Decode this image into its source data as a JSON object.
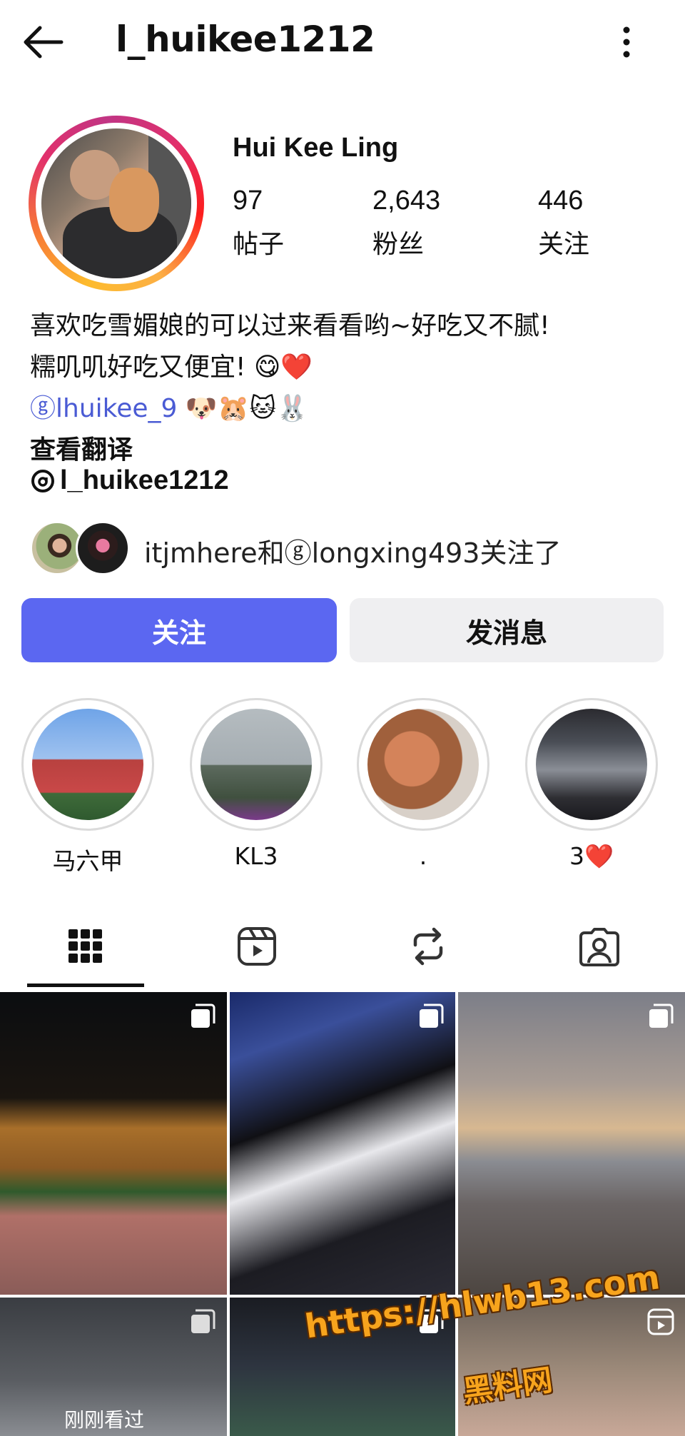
{
  "header": {
    "username": "l_huikee1212",
    "back_icon": "arrow-left-icon",
    "more_icon": "more-vertical-icon"
  },
  "profile": {
    "display_name": "Hui Kee Ling",
    "stats": [
      {
        "value": "97",
        "label": "帖子"
      },
      {
        "value": "2,643",
        "label": "粉丝"
      },
      {
        "value": "446",
        "label": "关注"
      }
    ],
    "bio_line1": "喜欢吃雪媚娘的可以过来看看哟~好吃又不腻!",
    "bio_line2": "糯叽叽好吃又便宜!  😋❤️",
    "bio_mention": "ⓖlhuikee_9",
    "bio_emojis": " 🐶🐹🐱🐰",
    "translate_label": "查看翻译",
    "threads_handle": "l_huikee1212",
    "mutual_followers_text": "itjmhere和ⓖlongxing493关注了"
  },
  "actions": {
    "follow_label": "关注",
    "message_label": "发消息",
    "follow_color": "#5b67f1"
  },
  "highlights": [
    {
      "label": "马六甲"
    },
    {
      "label": "KL3"
    },
    {
      "label": "."
    },
    {
      "label": "3❤️"
    }
  ],
  "tabs": [
    {
      "name": "grid",
      "icon": "grid-icon",
      "active": true
    },
    {
      "name": "reels",
      "icon": "reels-icon",
      "active": false
    },
    {
      "name": "reposts",
      "icon": "repost-icon",
      "active": false
    },
    {
      "name": "tagged",
      "icon": "tagged-person-icon",
      "active": false
    }
  ],
  "grid_overlay_text": "刚刚看过",
  "watermark": {
    "url": "https://hlwb13.com",
    "name": "黑料网"
  }
}
